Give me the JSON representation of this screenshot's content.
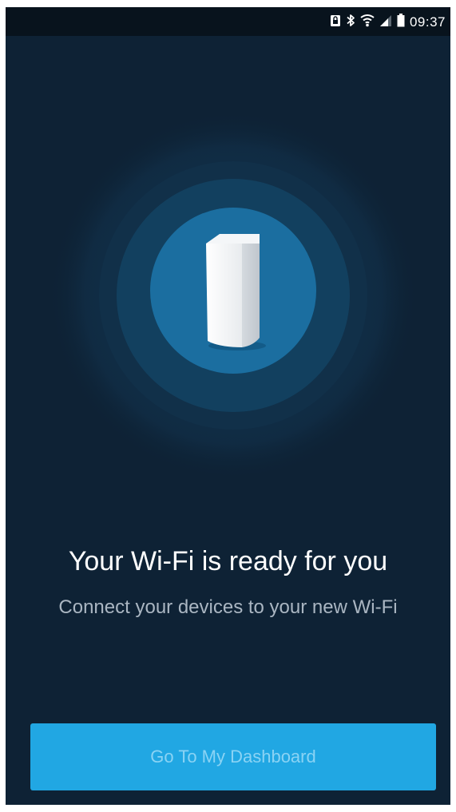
{
  "status_bar": {
    "time": "09:37",
    "icons": [
      "screen-lock-icon",
      "bluetooth-icon",
      "wifi-icon",
      "signal-icon",
      "battery-icon"
    ]
  },
  "hero": {
    "device": "mesh-router-node",
    "title": "Your Wi-Fi is ready for you",
    "subtitle": "Connect your devices to your new Wi-Fi"
  },
  "actions": {
    "primary_label": "Go To My Dashboard"
  },
  "colors": {
    "background": "#0e2235",
    "status_bar": "#08131d",
    "ring_inner": "#1b6ea0",
    "ring_middle": "#134566",
    "ring_outer": "#112f48",
    "button": "#21a7e3",
    "button_text": "#8ad3f4"
  }
}
